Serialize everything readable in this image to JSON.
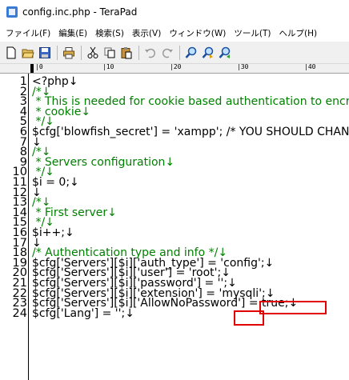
{
  "window": {
    "title": "config.inc.php - TeraPad"
  },
  "menu": [
    "ファイル(F)",
    "編集(E)",
    "検索(S)",
    "表示(V)",
    "ウィンドウ(W)",
    "ツール(T)",
    "ヘルプ(H)"
  ],
  "toolbar": {
    "buttons": [
      {
        "name": "new-file-icon"
      },
      {
        "name": "open-file-icon"
      },
      {
        "name": "save-icon"
      },
      {
        "name": "print-icon"
      },
      {
        "name": "cut-icon"
      },
      {
        "name": "copy-icon"
      },
      {
        "name": "paste-icon"
      },
      {
        "name": "undo-icon"
      },
      {
        "name": "redo-icon"
      },
      {
        "name": "search-icon"
      },
      {
        "name": "search-next-icon"
      },
      {
        "name": "search-prev-icon"
      }
    ]
  },
  "ruler": {
    "marks": [
      "|0",
      "|10",
      "|20",
      "|30",
      "|40"
    ]
  },
  "editor": {
    "line_numbers": [
      "1",
      "2",
      "3",
      "4",
      "5",
      "6",
      "7",
      "8",
      "9",
      "10",
      "11",
      "12",
      "13",
      "14",
      "15",
      "16",
      "17",
      "18",
      "19",
      "20",
      "21",
      "22",
      "23",
      "24"
    ],
    "lines": [
      "<?php↓",
      "/*↓",
      " * This is needed for cookie based authentication to encrypt password in",
      " * cookie↓",
      " */↓",
      "$cfg['blowfish_secret'] = 'xampp'; /* YOU SHOULD CHANGE THIS FOR A MORE",
      "↓",
      "/*↓",
      " * Servers configuration↓",
      " */↓",
      "$i = 0;↓",
      "↓",
      "/*↓",
      " * First server↓",
      " */↓",
      "$i++;↓",
      "↓",
      "/* Authentication type and info */↓",
      "$cfg['Servers'][$i]['auth_type'] = 'config';↓",
      "$cfg['Servers'][$i]['user'] = 'root';↓",
      "$cfg['Servers'][$i]['password'] = '';↓",
      "$cfg['Servers'][$i]['extension'] = 'mysqli';↓",
      "$cfg['Servers'][$i]['AllowNoPassword'] = true;↓",
      "$cfg['Lang'] = '';↓"
    ]
  },
  "highlight_color": "#e00000",
  "comment_color": "#008000",
  "newline_color": "#0000d0"
}
